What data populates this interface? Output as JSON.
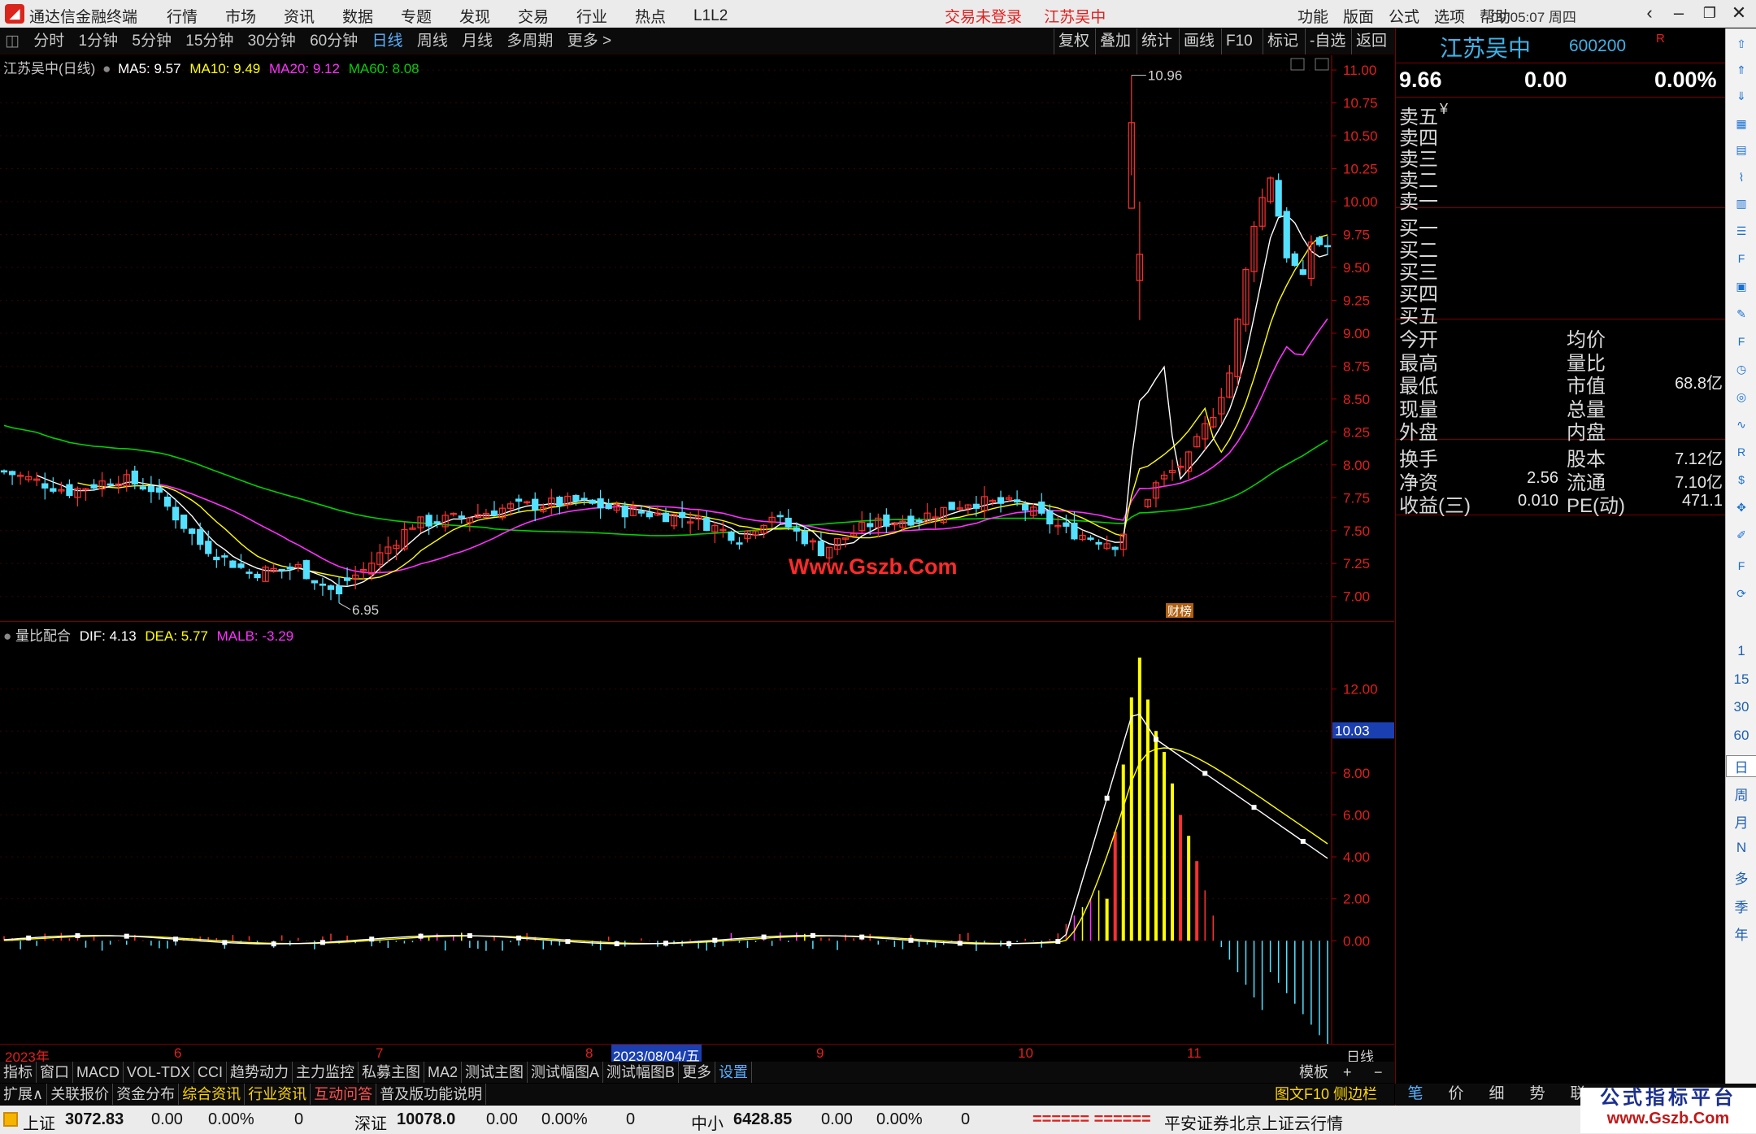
{
  "app": {
    "title": "通达信金融终端",
    "menus": [
      "行情",
      "市场",
      "资讯",
      "数据",
      "专题",
      "发现",
      "交易",
      "行业",
      "热点",
      "L1L2"
    ],
    "login_status": "交易未登录",
    "stock_name": "江苏吴中",
    "right_menus": [
      "功能",
      "版面",
      "公式",
      "选项",
      "帮助"
    ],
    "clock": "09:05:07 周四"
  },
  "periods": [
    "分时",
    "1分钟",
    "5分钟",
    "15分钟",
    "30分钟",
    "60分钟",
    "日线",
    "周线",
    "月线",
    "多周期",
    "更多 >"
  ],
  "active_period": "日线",
  "chart_tools": [
    "复权",
    "叠加",
    "统计",
    "画线",
    "F10",
    "标记",
    "-自选",
    "返回"
  ],
  "main_legend": {
    "title": "江苏吴中(日线)",
    "ma5": "MA5: 9.57",
    "ma10": "MA10: 9.49",
    "ma20": "MA20: 9.12",
    "ma60": "MA60: 8.08"
  },
  "ind_legend": {
    "name": "量比配合",
    "dif": "DIF: 4.13",
    "dea": "DEA: 5.77",
    "malb": "MALB: -3.29"
  },
  "watermark": "Www.Gszb.Com",
  "price_axis": [
    "11.00",
    "10.75",
    "10.50",
    "10.25",
    "10.00",
    "9.75",
    "9.50",
    "9.25",
    "9.00",
    "8.75",
    "8.50",
    "8.25",
    "8.00",
    "7.75",
    "7.50",
    "7.25",
    "7.00"
  ],
  "ind_axis": [
    "12.00",
    "10.00",
    "8.00",
    "6.00",
    "4.00",
    "2.00",
    "0.00"
  ],
  "ind_cursor": "10.03",
  "high_label": "10.96",
  "low_label": "6.95",
  "event_tag": "财榜",
  "time_axis": {
    "labels": [
      "2023年",
      "6",
      "7",
      "8",
      "2023/08/04/五",
      "9",
      "10",
      "11"
    ],
    "unit": "日线"
  },
  "tabs1": [
    "指标",
    "窗口",
    "MACD",
    "VOL-TDX",
    "CCI",
    "趋势动力",
    "主力监控",
    "私募主图",
    "MA2",
    "测试主图",
    "测试幅图A",
    "测试幅图B",
    "更多",
    "设置"
  ],
  "tabs1_right": [
    "模板",
    "+",
    "−"
  ],
  "tabs2": [
    "扩展∧",
    "关联报价",
    "资金分布",
    "综合资讯",
    "行业资讯",
    "互动问答",
    "普及版功能说明"
  ],
  "tabs2_right": "图文F10 侧边栏 《",
  "quote": {
    "name": "江苏吴中",
    "code": "600200",
    "r_mark": "R",
    "price": "9.66",
    "change": "0.00",
    "pct": "0.00%",
    "asks": [
      "卖五",
      "卖四",
      "卖三",
      "卖二",
      "卖一"
    ],
    "ask_suffix": "¥",
    "bids": [
      "买一",
      "买二",
      "买三",
      "买四",
      "买五"
    ],
    "left_labels": [
      "今开",
      "最高",
      "最低",
      "现量",
      "外盘"
    ],
    "right_labels": [
      "均价",
      "量比",
      "市值",
      "总量",
      "内盘"
    ],
    "market_cap": "68.8亿",
    "stats": [
      {
        "l": "换手",
        "lv": "",
        "r": "股本",
        "rv": "7.12亿"
      },
      {
        "l": "净资",
        "lv": "2.56",
        "r": "流通",
        "rv": "7.10亿"
      },
      {
        "l": "收益(三)",
        "lv": "0.010",
        "r": "PE(动)",
        "rv": "471.1"
      }
    ]
  },
  "bottom_tabs": [
    "笔",
    "价",
    "细",
    "势",
    "联"
  ],
  "sidebar_numbers": [
    "1",
    "15",
    "30",
    "60",
    "日",
    "周",
    "月",
    "N",
    "多",
    "季",
    "年"
  ],
  "status": {
    "sh": {
      "name": "上证",
      "val": "3072.83",
      "chg": "0.00",
      "pct": "0.00%",
      "vol": "0"
    },
    "sz": {
      "name": "深证",
      "val": "10078.0",
      "chg": "0.00",
      "pct": "0.00%",
      "vol": "0"
    },
    "zx": {
      "name": "中小",
      "val": "6428.85",
      "chg": "0.00",
      "pct": "0.00%",
      "vol": "0"
    },
    "bars": "====== ======",
    "broker": "平安证券北京上证云行情"
  },
  "watermark_brand": {
    "cn": "公式指标平台",
    "url": "www.Gszb.Com"
  },
  "chart_data": {
    "type": "candlestick",
    "y_range": [
      6.85,
      11.05
    ],
    "note_series": [
      "MA5",
      "MA10",
      "MA20",
      "MA60"
    ],
    "colors": {
      "up": "#ff3030",
      "down": "#54e0ff",
      "ma5": "#ffffff",
      "ma10": "#ffff00",
      "ma20": "#ff30ff",
      "ma60": "#00d000"
    }
  }
}
